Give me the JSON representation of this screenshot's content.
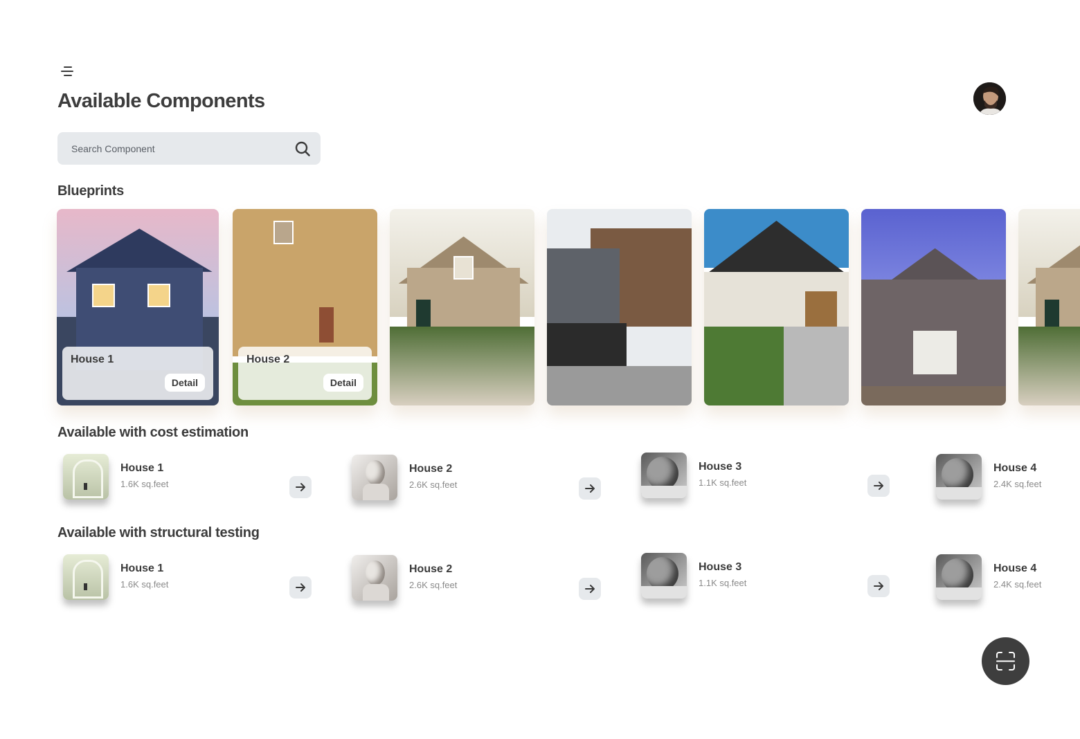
{
  "header": {
    "title": "Available Components",
    "menu_icon": "hamburger-icon",
    "avatar_icon": "user-avatar"
  },
  "search": {
    "placeholder": "Search Component",
    "icon": "search-icon"
  },
  "blueprints": {
    "title": "Blueprints",
    "detail_label": "Detail",
    "cards": [
      {
        "name": "House 1"
      },
      {
        "name": "House 2"
      }
    ]
  },
  "cost_estimation": {
    "title": "Available with cost estimation",
    "items": [
      {
        "name": "House 1",
        "size": "1.6K sq.feet"
      },
      {
        "name": "House 2",
        "size": "2.6K sq.feet"
      },
      {
        "name": "House 3",
        "size": "1.1K sq.feet"
      },
      {
        "name": "House 4",
        "size": "2.4K sq.feet"
      }
    ]
  },
  "structural_testing": {
    "title": "Available with  structural testing",
    "items": [
      {
        "name": "House 1",
        "size": "1.6K sq.feet"
      },
      {
        "name": "House 2",
        "size": "2.6K sq.feet"
      },
      {
        "name": "House 3",
        "size": "1.1K sq.feet"
      },
      {
        "name": "House 4",
        "size": "2.4K sq.feet"
      }
    ]
  },
  "fab": {
    "icon": "scan-icon"
  },
  "colors": {
    "text": "#3a3a3a",
    "muted": "#8a8a8a",
    "input_bg": "#e6e9ec",
    "fab_bg": "#3e3e3e"
  }
}
